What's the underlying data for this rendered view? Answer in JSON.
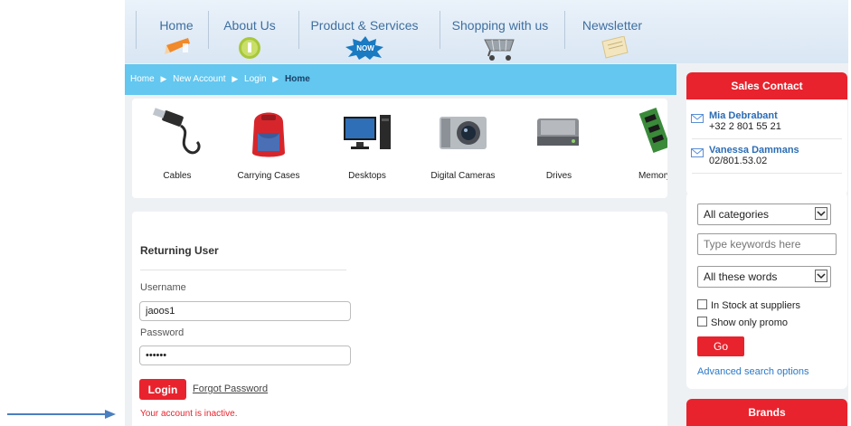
{
  "nav": {
    "items": [
      {
        "label": "Home"
      },
      {
        "label": "About Us"
      },
      {
        "label": "Product & Services"
      },
      {
        "label": "Shopping with us"
      },
      {
        "label": "Newsletter"
      }
    ],
    "badge_now": "NOW"
  },
  "breadcrumb": {
    "items": [
      "Home",
      "New Account",
      "Login"
    ],
    "current": "Home"
  },
  "categories": [
    {
      "label": "Cables",
      "icon": "cable-icon"
    },
    {
      "label": "Carrying Cases",
      "icon": "backpack-icon"
    },
    {
      "label": "Desktops",
      "icon": "desktop-computer-icon"
    },
    {
      "label": "Digital Cameras",
      "icon": "camera-icon"
    },
    {
      "label": "Drives",
      "icon": "hard-drive-icon"
    },
    {
      "label": "Memory",
      "icon": "memory-module-icon"
    }
  ],
  "login": {
    "heading": "Returning User",
    "username_label": "Username",
    "username_value": "jaoos1",
    "password_label": "Password",
    "password_value": "••••••",
    "login_button": "Login",
    "forgot_link": "Forgot Password",
    "error_message": "Your account is inactive."
  },
  "sales_contact": {
    "title": "Sales Contact",
    "contacts": [
      {
        "name": "Mia Debrabant",
        "phone": "+32 2 801 55 21"
      },
      {
        "name": "Vanessa Dammans",
        "phone": "02/801.53.02"
      }
    ]
  },
  "search": {
    "category_select": "All categories",
    "keywords_placeholder": "Type keywords here",
    "match_select": "All these words",
    "in_stock_label": "In Stock at suppliers",
    "promo_label": "Show only promo",
    "go_button": "Go",
    "advanced_link": "Advanced search options"
  },
  "brands": {
    "title": "Brands"
  },
  "colors": {
    "accent_red": "#e8232d",
    "breadcrumb_bar": "#63c7ef",
    "link_blue": "#2b6cb5",
    "arrow_blue": "#4a7fc0"
  }
}
